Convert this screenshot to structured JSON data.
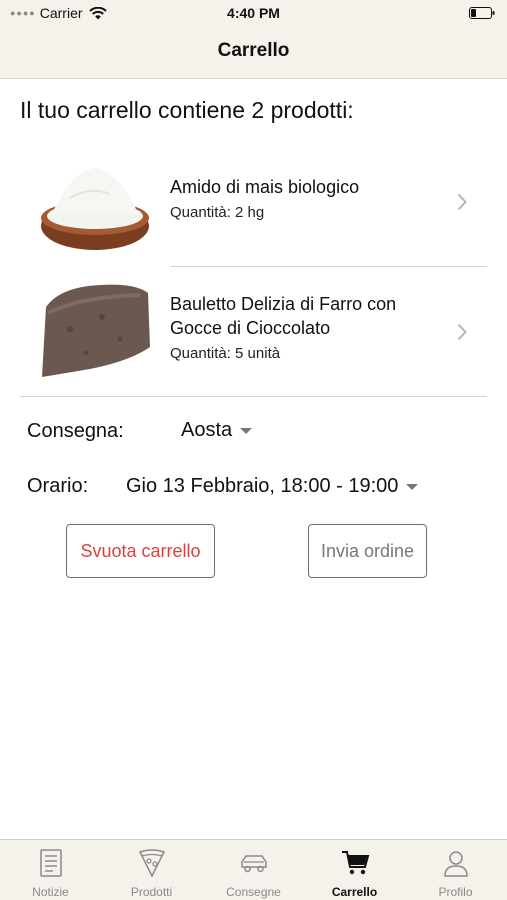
{
  "status_bar": {
    "carrier": "Carrier",
    "time": "4:40 PM"
  },
  "nav": {
    "title": "Carrello"
  },
  "cart": {
    "summary": "Il tuo carrello contiene 2 prodotti:",
    "items": [
      {
        "name": "Amido di mais biologico",
        "quantity": "Quantità: 2 hg",
        "image": "flour-bowl-image"
      },
      {
        "name": "Bauletto Delizia di Farro con Gocce di Cioccolato",
        "quantity": "Quantità: 5 unità",
        "image": "bread-loaf-image"
      }
    ]
  },
  "delivery": {
    "label": "Consegna:",
    "value": "Aosta"
  },
  "schedule": {
    "label": "Orario:",
    "value": "Gio 13 Febbraio, 18:00 - 19:00"
  },
  "buttons": {
    "clear": "Svuota carrello",
    "send": "Invia ordine"
  },
  "colors": {
    "bar_bg": "#f4f2ea",
    "danger": "#e0403a",
    "disabled": "#777777"
  },
  "tabs": [
    {
      "label": "Notizie",
      "icon": "newspaper-icon",
      "active": false
    },
    {
      "label": "Prodotti",
      "icon": "pizza-slice-icon",
      "active": false
    },
    {
      "label": "Consegne",
      "icon": "car-icon",
      "active": false
    },
    {
      "label": "Carrello",
      "icon": "shopping-cart-icon",
      "active": true
    },
    {
      "label": "Profilo",
      "icon": "person-icon",
      "active": false
    }
  ]
}
